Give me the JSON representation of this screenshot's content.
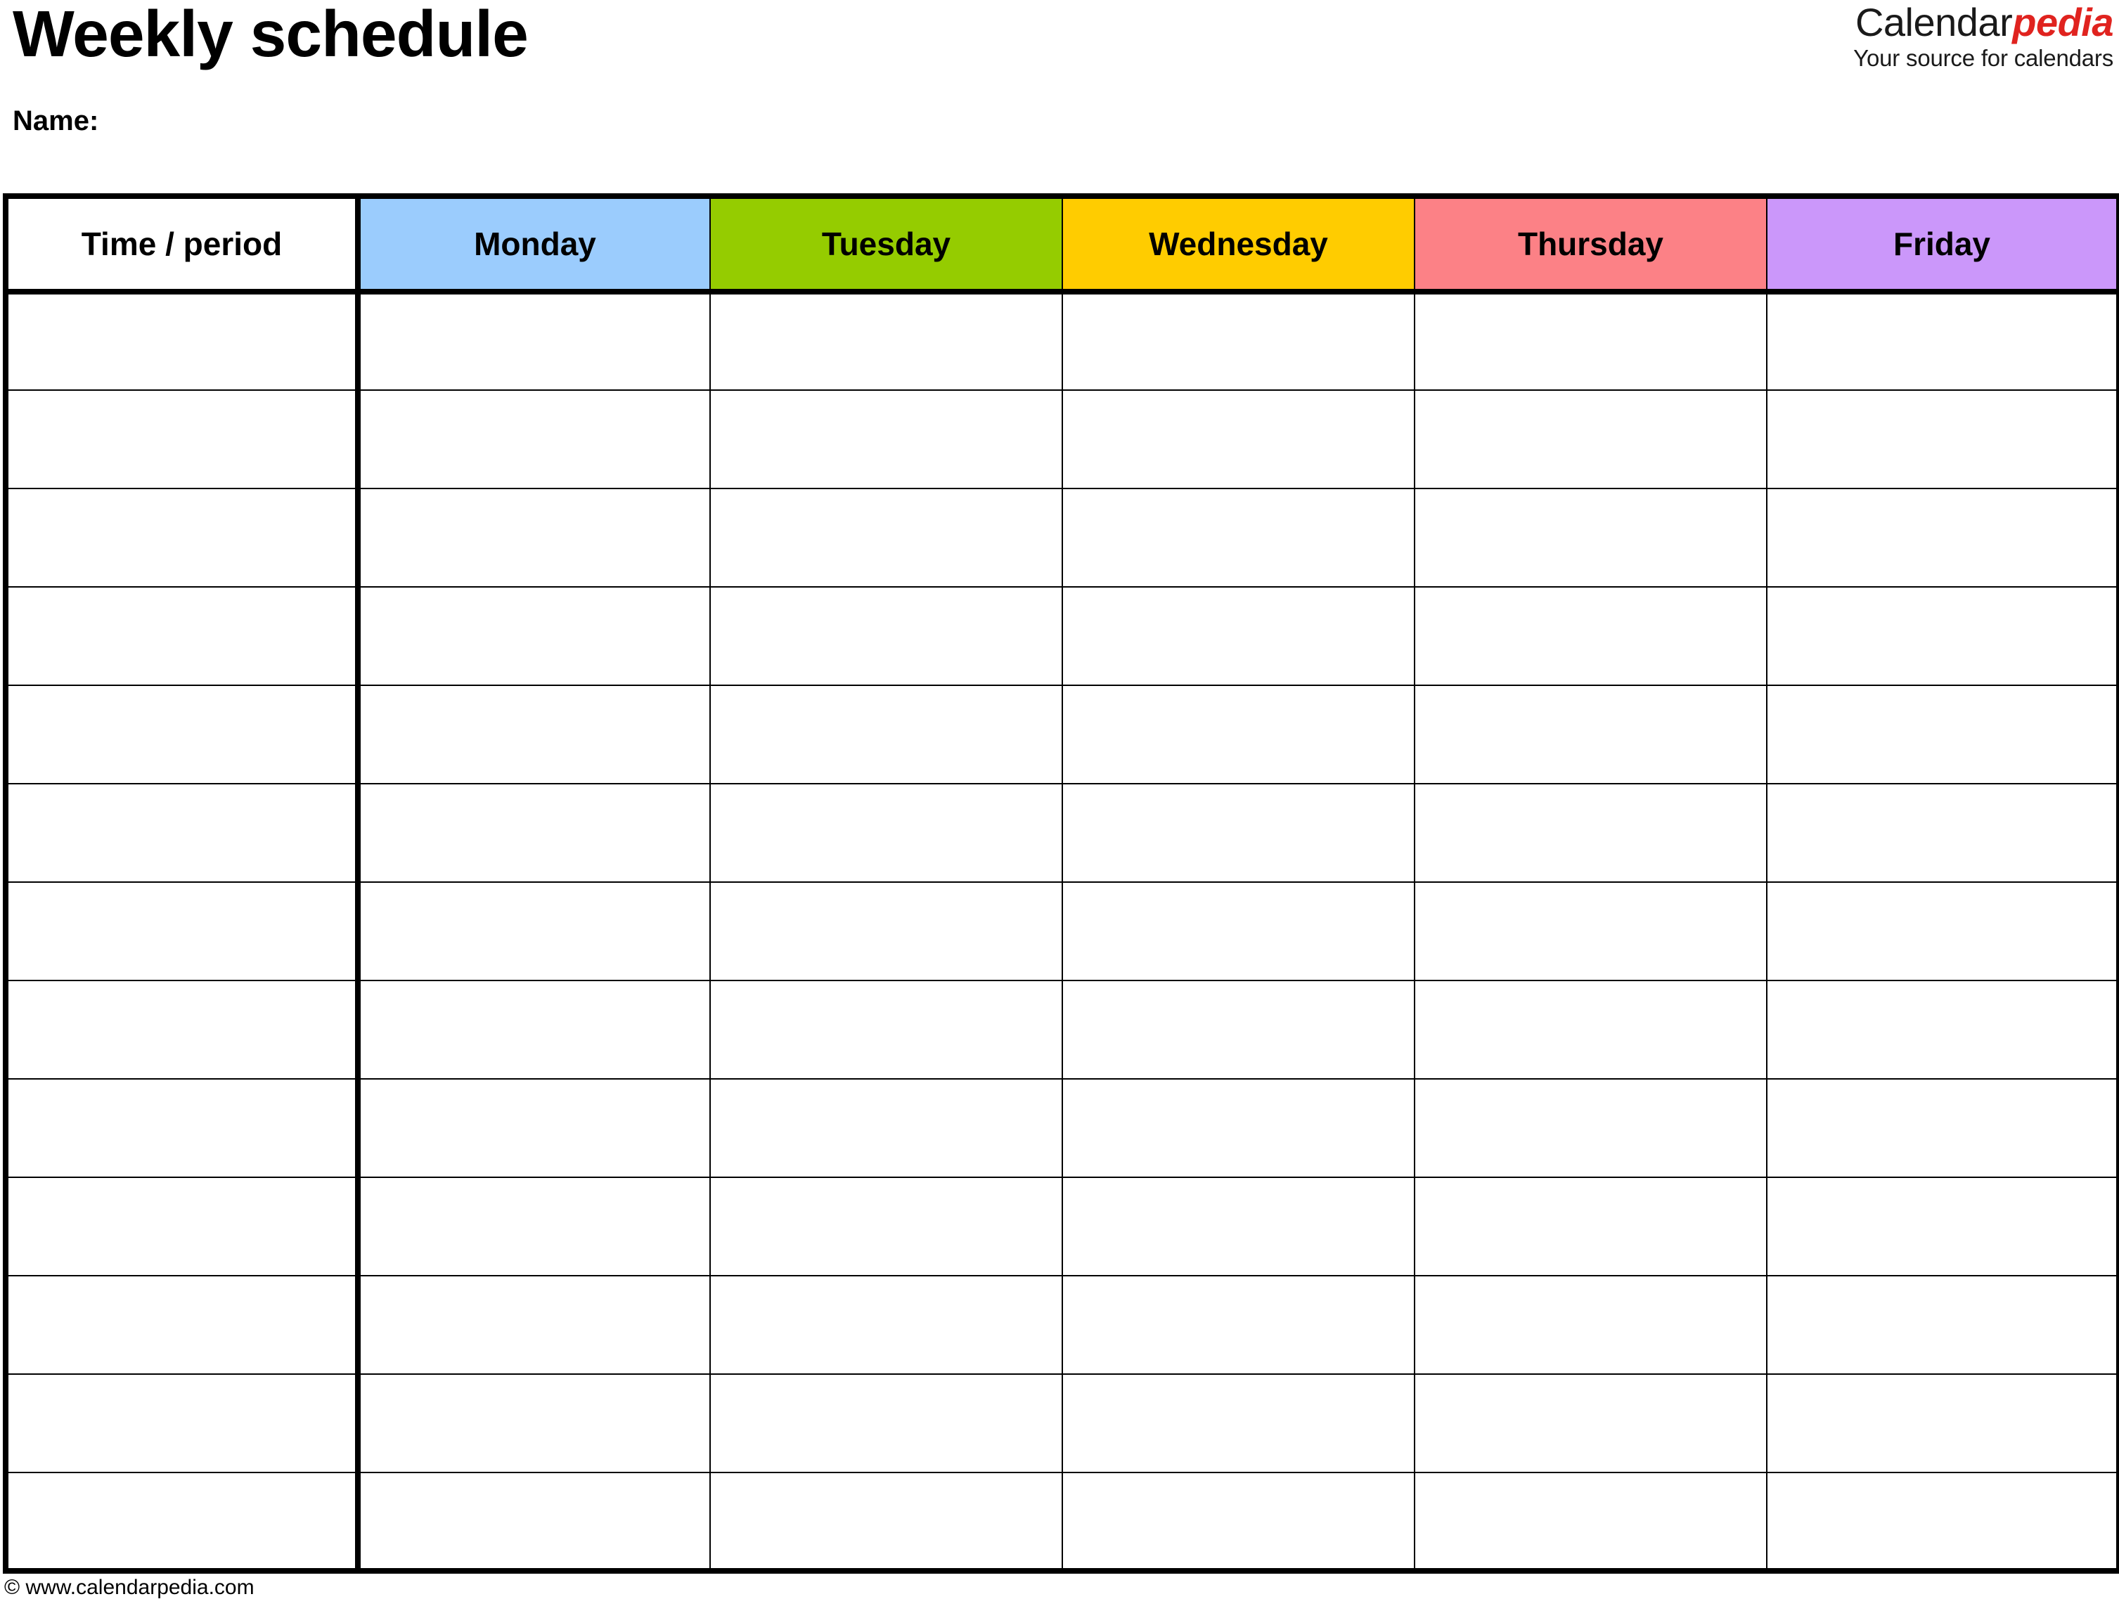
{
  "document": {
    "title": "Weekly schedule",
    "name_label": "Name:"
  },
  "logo": {
    "brand_first": "Calendar",
    "brand_second": "pedia",
    "tagline": "Your source for calendars",
    "brand_second_color": "#e0231f"
  },
  "table": {
    "columns": [
      {
        "label": "Time / period",
        "color": "#ffffff",
        "key": "time"
      },
      {
        "label": "Monday",
        "color": "#9bccfd",
        "key": "monday"
      },
      {
        "label": "Tuesday",
        "color": "#95cc00",
        "key": "tuesday"
      },
      {
        "label": "Wednesday",
        "color": "#ffcc00",
        "key": "wednesday"
      },
      {
        "label": "Thursday",
        "color": "#fc8186",
        "key": "thursday"
      },
      {
        "label": "Friday",
        "color": "#cb97fa",
        "key": "friday"
      }
    ],
    "row_count": 13,
    "rows": [
      {
        "time": "",
        "monday": "",
        "tuesday": "",
        "wednesday": "",
        "thursday": "",
        "friday": ""
      },
      {
        "time": "",
        "monday": "",
        "tuesday": "",
        "wednesday": "",
        "thursday": "",
        "friday": ""
      },
      {
        "time": "",
        "monday": "",
        "tuesday": "",
        "wednesday": "",
        "thursday": "",
        "friday": ""
      },
      {
        "time": "",
        "monday": "",
        "tuesday": "",
        "wednesday": "",
        "thursday": "",
        "friday": ""
      },
      {
        "time": "",
        "monday": "",
        "tuesday": "",
        "wednesday": "",
        "thursday": "",
        "friday": ""
      },
      {
        "time": "",
        "monday": "",
        "tuesday": "",
        "wednesday": "",
        "thursday": "",
        "friday": ""
      },
      {
        "time": "",
        "monday": "",
        "tuesday": "",
        "wednesday": "",
        "thursday": "",
        "friday": ""
      },
      {
        "time": "",
        "monday": "",
        "tuesday": "",
        "wednesday": "",
        "thursday": "",
        "friday": ""
      },
      {
        "time": "",
        "monday": "",
        "tuesday": "",
        "wednesday": "",
        "thursday": "",
        "friday": ""
      },
      {
        "time": "",
        "monday": "",
        "tuesday": "",
        "wednesday": "",
        "thursday": "",
        "friday": ""
      },
      {
        "time": "",
        "monday": "",
        "tuesday": "",
        "wednesday": "",
        "thursday": "",
        "friday": ""
      },
      {
        "time": "",
        "monday": "",
        "tuesday": "",
        "wednesday": "",
        "thursday": "",
        "friday": ""
      },
      {
        "time": "",
        "monday": "",
        "tuesday": "",
        "wednesday": "",
        "thursday": "",
        "friday": ""
      }
    ]
  },
  "footer": {
    "credit": "© www.calendarpedia.com"
  }
}
